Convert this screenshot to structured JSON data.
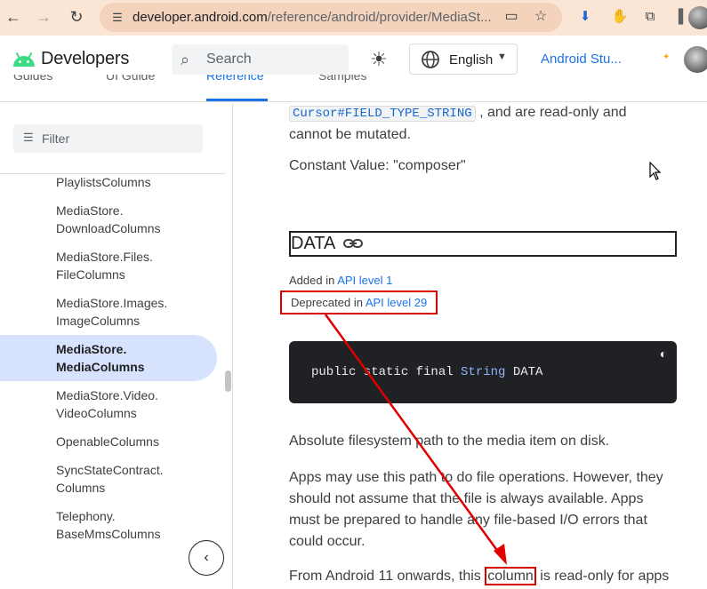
{
  "browser": {
    "url_host": "developer.android.com",
    "url_path": "/reference/android/provider/MediaSt..."
  },
  "header": {
    "brand": "Developers",
    "search_placeholder": "Search",
    "language": "English",
    "studio_link": "Android Stu..."
  },
  "tabs": [
    "Guides",
    "UI Guide",
    "Reference",
    "Samples"
  ],
  "sidebar": {
    "filter_placeholder": "Filter",
    "items": [
      {
        "line1": "PlaylistsColumns",
        "line2": ""
      },
      {
        "line1": "MediaStore.",
        "line2": "DownloadColumns"
      },
      {
        "line1": "MediaStore.Files.",
        "line2": "FileColumns"
      },
      {
        "line1": "MediaStore.Images.",
        "line2": "ImageColumns"
      },
      {
        "line1": "MediaStore.",
        "line2": "MediaColumns"
      },
      {
        "line1": "MediaStore.Video.",
        "line2": "VideoColumns"
      },
      {
        "line1": "OpenableColumns",
        "line2": ""
      },
      {
        "line1": "SyncStateContract.",
        "line2": "Columns"
      },
      {
        "line1": "Telephony.",
        "line2": "BaseMmsColumns"
      }
    ]
  },
  "content": {
    "intro_code": "Cursor#FIELD_TYPE_STRING",
    "intro_rest": ", and are read-only and",
    "intro_line2": "cannot be mutated.",
    "constant_value": "Constant Value: \"composer\"",
    "heading": "DATA",
    "added_prefix": "Added in ",
    "added_link": "API level 1",
    "deprecated_prefix": "Deprecated in ",
    "deprecated_link": "API level 29",
    "code": {
      "pre": "public static final ",
      "type": "String",
      "post": " DATA"
    },
    "description": "Absolute filesystem path to the media item on disk.",
    "para2": [
      "Apps may use this path to do file operations. However, they",
      "should not assume that the file is always available. Apps",
      "must be prepared to handle any file-based I/O errors that",
      "could occur."
    ],
    "para3_pre": "From Android 11 onwards, this ",
    "para3_hl": "column",
    "para3_post": " is read-only for apps"
  },
  "colors": {
    "annotation": "#d60000",
    "link": "#1a73e8",
    "selected_nav": "#d7e3fd"
  }
}
